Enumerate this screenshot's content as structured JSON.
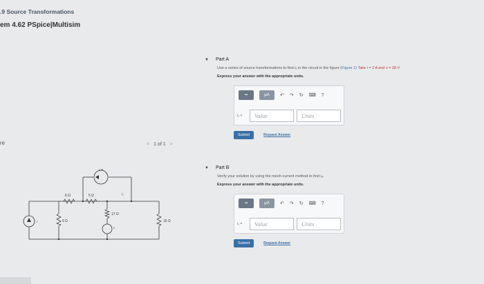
{
  "header": {
    "title": ".9 Source Transformations",
    "subtitle": "em 4.62 PSpice|Multisim"
  },
  "side_label": "re",
  "pager": {
    "prev": "<",
    "text": "1 of 1",
    "next": ">"
  },
  "figure": {
    "labels": {
      "source_1A": "1 A",
      "r6_top": "6 Ω",
      "r5_top": "5 Ω",
      "r17": "17 Ω",
      "r6_left": "6 Ω",
      "r15": "15 Ω",
      "current_i": "i",
      "voltage_v": "v",
      "io": "iₒ"
    }
  },
  "partA": {
    "title": "Part A",
    "question_pre": "Use a series of source transformations to find iₒ in the circuit in the figure",
    "figure_link": "(Figure 1)",
    "question_post": "Take i = 2 A and v = 28 V",
    "instruction": "Express your answer with the appropriate units.",
    "toolbar": {
      "templates": "▪▪",
      "mu": "μA",
      "undo": "↶",
      "redo": "↷",
      "reset": "↻",
      "keyboard": "⌨",
      "help": "?"
    },
    "var_label": "iₒ =",
    "value_placeholder": "Value",
    "units_placeholder": "Units",
    "submit": "Submit",
    "request": "Request Answer"
  },
  "partB": {
    "title": "Part B",
    "question": "Verify your solution by using the mesh-current method to find iₒ.",
    "instruction": "Express your answer with the appropriate units.",
    "toolbar": {
      "templates": "▪▪",
      "mu": "μA",
      "undo": "↶",
      "redo": "↷",
      "reset": "↻",
      "keyboard": "⌨",
      "help": "?"
    },
    "var_label": "iₒ =",
    "value_placeholder": "Value",
    "units_placeholder": "Units",
    "submit": "Submit",
    "request": "Request Answer"
  }
}
